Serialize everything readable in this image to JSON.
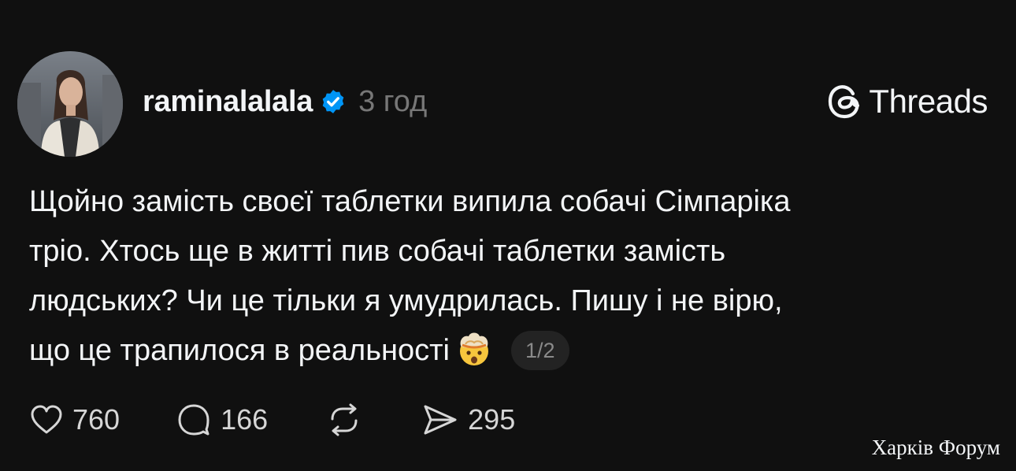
{
  "author": {
    "username": "raminalalala",
    "verified": true,
    "time": "3 год"
  },
  "brand": {
    "name": "Threads",
    "icon": "threads-at-icon"
  },
  "post": {
    "line1": "Щойно замість своєї таблетки випила собачі Сімпаріка",
    "line2": "тріо. Хтось ще в житті пив собачі таблетки замість",
    "line3": "людських? Чи це тільки я умудрилась. Пишу і не вірю,",
    "line4": "що це трапилося в реальності",
    "emoji": "exploding-head-emoji",
    "page_indicator": "1/2"
  },
  "actions": {
    "likes": "760",
    "replies": "166",
    "reposts": "",
    "shares": "295"
  },
  "watermark": "Харків Форум",
  "colors": {
    "background": "#101010",
    "text": "#f3f5f7",
    "muted": "#777777",
    "verified_blue": "#0095f6"
  }
}
